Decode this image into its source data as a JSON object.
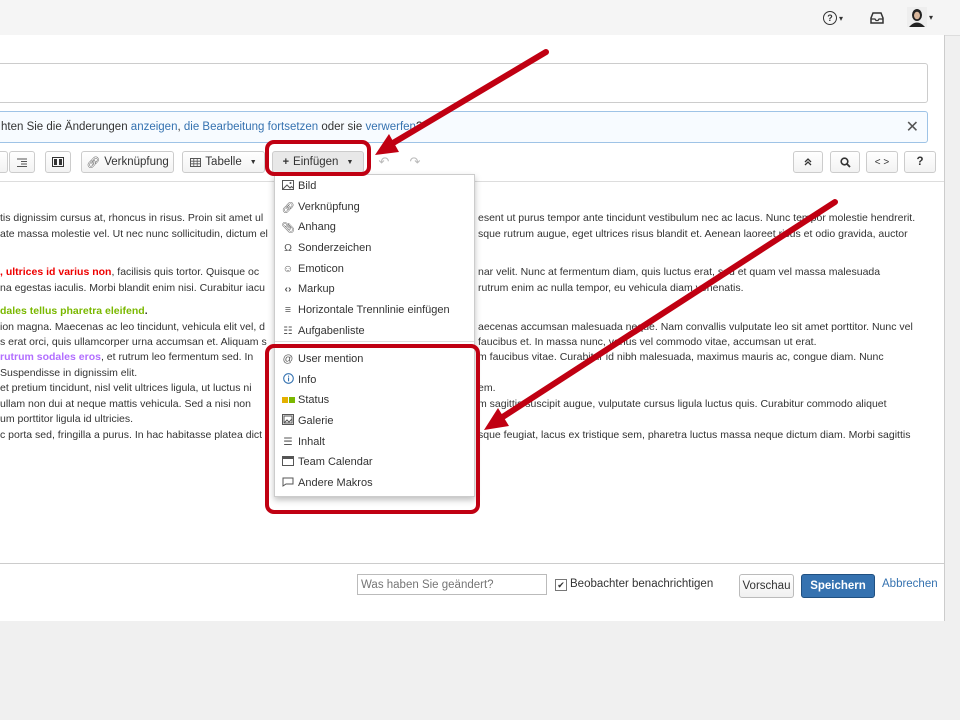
{
  "topbar": {
    "help_icon": "?",
    "caret": "▾",
    "notifications_icon": "tray-icon",
    "avatar_icon": "user-avatar-icon"
  },
  "draft_bar": {
    "prefix": "hten Sie die Änderungen ",
    "link_show": "anzeigen",
    "comma": ", ",
    "link_continue": "die Bearbeitung fortsetzen",
    "middle": " oder sie ",
    "link_discard": "verwerfen",
    "suffix": "?",
    "close": "✕"
  },
  "toolbar": {
    "link_label": "Verknüpfung",
    "table_label": "Tabelle",
    "insert_label": "Einfügen",
    "code_label": "< >",
    "help_label": "?"
  },
  "insert_menu": {
    "items": [
      {
        "label": "Bild",
        "icon": "image-icon"
      },
      {
        "label": "Verknüpfung",
        "icon": "link-icon"
      },
      {
        "label": "Anhang",
        "icon": "paperclip-icon"
      },
      {
        "label": "Sonderzeichen",
        "icon": "omega-icon"
      },
      {
        "label": "Emoticon",
        "icon": "smiley-icon"
      },
      {
        "label": "Markup",
        "icon": "markup-icon"
      },
      {
        "label": "Horizontale Trennlinie einfügen",
        "icon": "horizontal-rule-icon"
      },
      {
        "label": "Aufgabenliste",
        "icon": "task-list-icon"
      },
      {
        "label": "User mention",
        "icon": "at-icon"
      },
      {
        "label": "Info",
        "icon": "info-icon"
      },
      {
        "label": "Status",
        "icon": "status-icon"
      },
      {
        "label": "Galerie",
        "icon": "gallery-icon"
      },
      {
        "label": "Inhalt",
        "icon": "toc-icon"
      },
      {
        "label": "Team Calendar",
        "icon": "calendar-icon"
      },
      {
        "label": "Andere Makros",
        "icon": "macro-icon"
      }
    ]
  },
  "content": {
    "p1_l1_left": "tis dignissim cursus at, rhoncus in risus. Proin sit amet ul",
    "p1_l1_right": "esent ut purus tempor ante tincidunt vestibulum nec ac lacus. Nunc tempor molestie hendrerit.",
    "p1_l2_left": "ate massa molestie vel. Ut nec nunc sollicitudin, dictum el",
    "p1_l2_right": "sque rutrum augue, eget ultrices risus blandit et. Aenean laoreet risus et odio gravida, auctor",
    "p2_l1_red": ", ultrices id varius non",
    "p2_l1_left": ", facilisis quis tortor. Quisque oc",
    "p2_l1_right": "nar velit. Nunc at fermentum diam, quis luctus erat, sed et quam vel massa malesuada",
    "p2_l2_left": "na egestas iaculis. Morbi blandit enim nisi. Curabitur iacu",
    "p2_l2_right": "rutrum enim ac nulla tempor, eu vehicula diam venenatis.",
    "p3_l1_green": "dales tellus pharetra eleifend",
    "p3_l1_dot": ".",
    "p3_l2_left": "ion magna. Maecenas ac leo tincidunt, vehicula elit vel, d",
    "p3_l2_right": "aecenas accumsan malesuada neque. Nam convallis vulputate leo sit amet porttitor. Nunc vel",
    "p3_l3_left": "s erat orci, quis ullamcorper urna accumsan et. Aliquam s",
    "p3_l3_right": "faucibus et. In massa nunc, varius vel commodo vitae, accumsan ut erat.",
    "p3_l4_purple": " rutrum sodales eros",
    "p3_l4_left": ", et rutrum leo fermentum sed. In",
    "p3_l4_right": "m faucibus vitae. Curabitur id nibh malesuada, maximus mauris ac, congue diam. Nunc",
    "p3_l5_left": "Suspendisse in dignissim elit.",
    "p3_l6_left": "et pretium tincidunt, nisl velit ultrices ligula, ut luctus ni",
    "p3_l6_right": "em.",
    "p3_l7_left": "ullam non dui at neque mattis vehicula. Sed a nisi non",
    "p3_l7_right": "m sagittis suscipit augue, vulputate cursus ligula luctus quis. Curabitur commodo aliquet",
    "p3_l8_left": "um porttitor ligula id ultricies.",
    "p3_l9_left": "c porta sed, fringilla a purus. In hac habitasse platea dict",
    "p3_l9_right": "sque feugiat, lacus ex tristique sem, pharetra luctus massa neque dictum diam. Morbi sagittis"
  },
  "footer": {
    "comment_placeholder": "Was haben Sie geändert?",
    "notify_label": "Beobachter benachrichtigen",
    "preview_label": "Vorschau",
    "save_label": "Speichern",
    "cancel_label": "Abbrechen"
  },
  "colors": {
    "annotation_red": "#c00012",
    "primary_blue": "#3572b0",
    "link_blue": "#3572b0"
  }
}
